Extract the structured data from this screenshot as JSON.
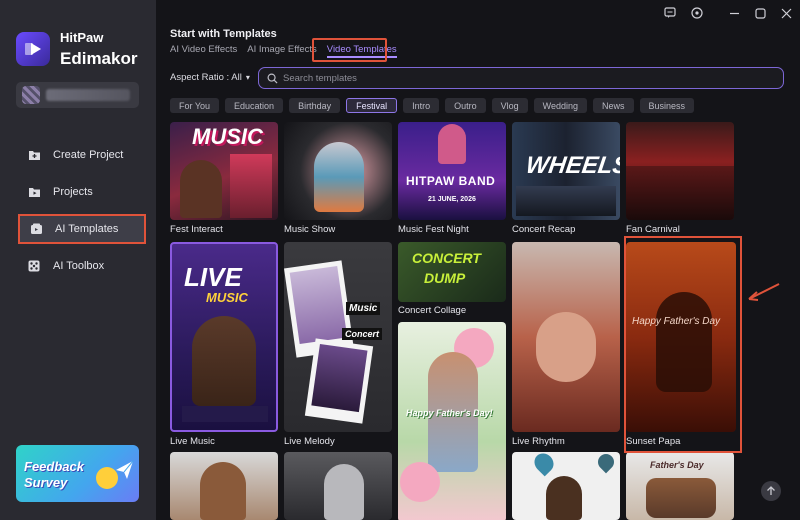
{
  "app": {
    "brand_top": "HitPaw",
    "brand_main": "Edimakor"
  },
  "sidebar": {
    "items": [
      {
        "label": "Create Project",
        "icon": "plus-folder-icon"
      },
      {
        "label": "Projects",
        "icon": "folder-icon"
      },
      {
        "label": "AI Templates",
        "icon": "ai-template-icon",
        "active": true
      },
      {
        "label": "AI Toolbox",
        "icon": "toolbox-icon"
      }
    ],
    "feedback": {
      "line1": "Feedback",
      "line2": "Survey"
    }
  },
  "main": {
    "title": "Start with Templates",
    "tabs": [
      {
        "label": "AI Video Effects"
      },
      {
        "label": "AI Image Effects"
      },
      {
        "label": "Video Templates",
        "active": true
      }
    ],
    "aspect_ratio": "Aspect Ratio : All",
    "search_placeholder": "Search templates",
    "categories": [
      "For You",
      "Education",
      "Birthday",
      "Festival",
      "Intro",
      "Outro",
      "Vlog",
      "Wedding",
      "News",
      "Business"
    ],
    "active_category": "Festival"
  },
  "templates": [
    {
      "label": "Fest Interact",
      "text": "MUSIC"
    },
    {
      "label": "Music Show",
      "text": ""
    },
    {
      "label": "Music Fest Night",
      "text": "HITPAW BAND",
      "sub": "21 JUNE, 2026"
    },
    {
      "label": "Concert Recap",
      "text": "WHEELS"
    },
    {
      "label": "Fan Carnival",
      "text": ""
    },
    {
      "label": "Live Music",
      "text": "LIVE",
      "sub": "MUSIC"
    },
    {
      "label": "Live Melody",
      "text": "Music",
      "sub": "Concert"
    },
    {
      "label": "Concert Collage",
      "text": "CONCERT",
      "sub": "DUMP"
    },
    {
      "label": "Live Rhythm",
      "text": ""
    },
    {
      "label": "Sunset Papa",
      "text": "Happy Father's Day"
    },
    {
      "label": "",
      "text": "Happy Father's Day!"
    },
    {
      "label": "",
      "text": ""
    },
    {
      "label": "",
      "text": ""
    },
    {
      "label": "",
      "text": ""
    },
    {
      "label": "",
      "text": "Father's Day"
    }
  ],
  "colors": {
    "accent": "#8e76e8",
    "highlight": "#e0533a",
    "sidebar_bg": "#2a2a31",
    "main_bg": "#141418"
  }
}
